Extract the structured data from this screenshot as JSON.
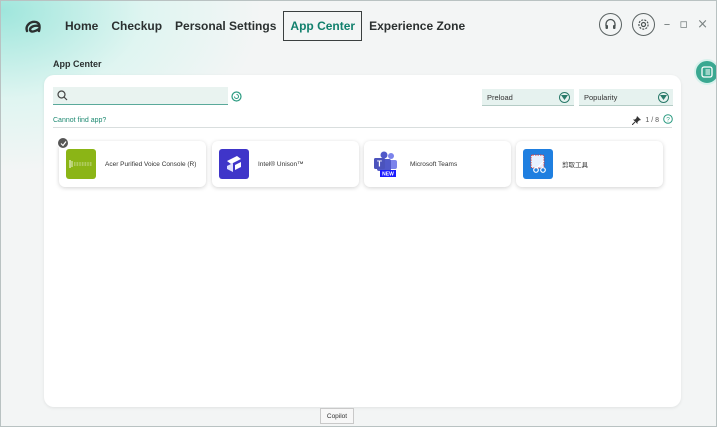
{
  "nav": {
    "items": [
      {
        "label": "Home"
      },
      {
        "label": "Checkup"
      },
      {
        "label": "Personal Settings"
      },
      {
        "label": "App Center",
        "active": true
      },
      {
        "label": "Experience Zone"
      }
    ]
  },
  "window_controls": {
    "minimize": "–",
    "restore": "▫",
    "close": "×"
  },
  "section": {
    "title": "App Center"
  },
  "search": {
    "value": "",
    "placeholder": ""
  },
  "filters": {
    "preload": "Preload",
    "sort": "Popularity"
  },
  "help_link": "Cannot find app?",
  "pager": {
    "text": "1 / 8"
  },
  "apps": [
    {
      "name": "Acer Purified Voice Console (R)",
      "icon": "waveform-icon",
      "color": "#8bb516",
      "installed": true
    },
    {
      "name": "Intel® Unison™",
      "icon": "unison-icon",
      "color": "#4a3fd6"
    },
    {
      "name": "Microsoft Teams",
      "icon": "teams-icon",
      "color": "#5059c9",
      "badge": "NEW"
    },
    {
      "name": "剪取工具",
      "icon": "snipping-tool-icon",
      "color": "#1f7fe0"
    }
  ],
  "tooltip": "Copilot",
  "colors": {
    "accent": "#12806d",
    "panel": "#ffffff",
    "teal": "#3aa891"
  }
}
